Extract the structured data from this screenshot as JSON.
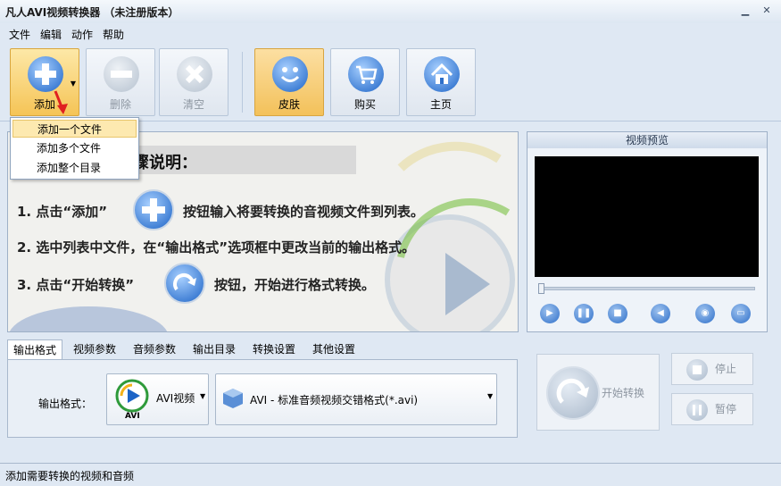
{
  "window": {
    "title": "凡人AVI视频转换器 （未注册版本）"
  },
  "menu": [
    "文件",
    "编辑",
    "动作",
    "帮助"
  ],
  "toolbar": {
    "add": "添加",
    "delete": "删除",
    "clear": "清空",
    "skin": "皮肤",
    "buy": "购买",
    "home": "主页"
  },
  "dropdown": {
    "items": [
      "添加一个文件",
      "添加多个文件",
      "添加整个目录"
    ]
  },
  "guide": {
    "header": "骤说明：",
    "step1_a": "1. 点击“添加”",
    "step1_b": "按钮输入将要转换的音视频文件到列表。",
    "step2": "2. 选中列表中文件，在“输出格式”选项框中更改当前的输出格式。",
    "step3_a": "3. 点击“开始转换”",
    "step3_b": "按钮，开始进行格式转换。"
  },
  "preview": {
    "title": "视频预览"
  },
  "tabs": [
    "输出格式",
    "视频参数",
    "音频参数",
    "输出目录",
    "转换设置",
    "其他设置"
  ],
  "output": {
    "label": "输出格式：",
    "format_name": "AVI视频",
    "format_badge": "AVI",
    "format_desc": "AVI - 标准音频视频交错格式(*.avi)"
  },
  "actions": {
    "start": "开始转换",
    "stop": "停止",
    "pause": "暂停"
  },
  "status": {
    "text": "添加需要转换的视频和音频"
  },
  "colors": {
    "accent": "#2e6fc9",
    "highlight": "#fde9b0",
    "arrow": "#e02020"
  }
}
